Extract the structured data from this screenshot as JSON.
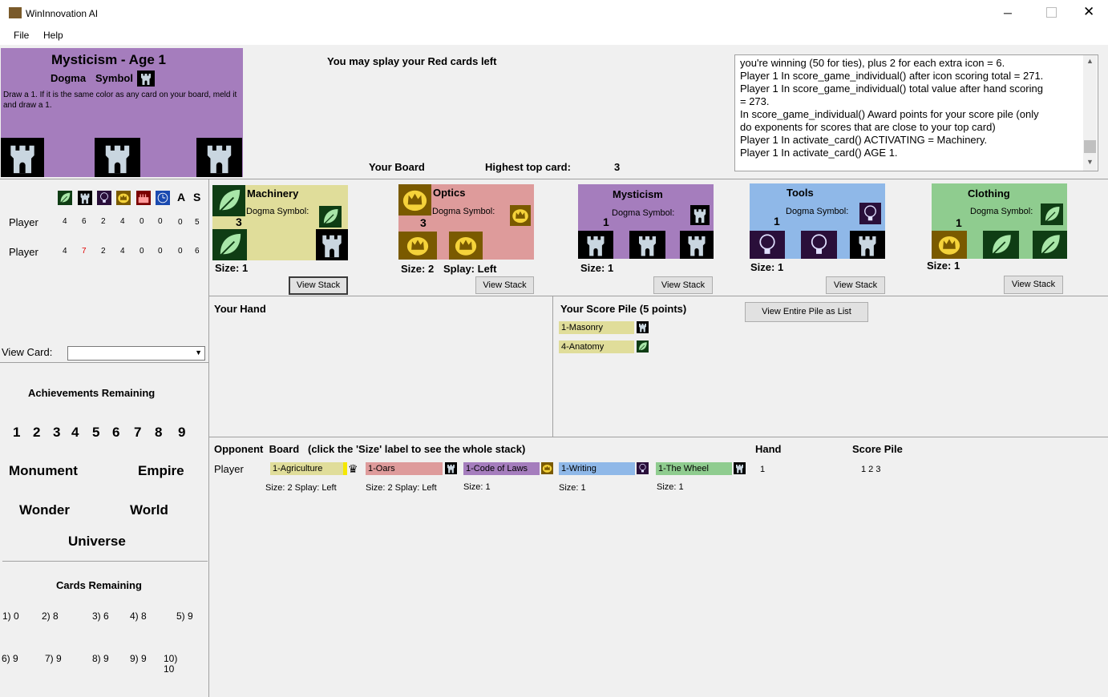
{
  "window": {
    "title": "WinInnovation AI"
  },
  "menu": {
    "file": "File",
    "help": "Help"
  },
  "selected_card": {
    "title": "Mysticism - Age 1",
    "dogma_label": "Dogma",
    "symbol_label": "Symbol",
    "text": "Draw a 1. If it is the same color as any card on your board, meld it and draw a 1.",
    "color": "#a57dbd"
  },
  "prompt": "You may splay your Red cards left",
  "log_lines": [
    "you're winning (50 for ties), plus 2 for each extra icon = 6.",
    "Player 1 In score_game_individual() after icon scoring total = 271.",
    "Player 1 In score_game_individual()  total value after hand scoring",
    "= 273.",
    "In score_game_individual()  Award points for your score pile (only",
    "do exponents for scores that are close to your top card)",
    "Player 1 In activate_card() ACTIVATING = Machinery.",
    "Player 1 In activate_card() AGE 1."
  ],
  "board_header": {
    "your_board": "Your Board",
    "highest_label": "Highest top card:",
    "highest_value": "3"
  },
  "icon_table": {
    "headers_text": [
      "A",
      "S"
    ],
    "rows": [
      {
        "label": "Player",
        "values": [
          "4",
          "6",
          "2",
          "4",
          "0",
          "0",
          "0",
          "5"
        ]
      },
      {
        "label": "Player",
        "values": [
          "4",
          "7",
          "2",
          "4",
          "0",
          "0",
          "0",
          "6"
        ]
      }
    ]
  },
  "view_card": {
    "label": "View Card:",
    "value": ""
  },
  "achievements": {
    "title": "Achievements Remaining",
    "numbers": [
      "1",
      "2",
      "3",
      "4",
      "5",
      "6",
      "7",
      "8",
      "9"
    ],
    "special": [
      "Monument",
      "Empire",
      "Wonder",
      "World",
      "Universe"
    ]
  },
  "cards_remaining": {
    "title": "Cards Remaining",
    "items": [
      "1) 0",
      "2) 8",
      "3) 6",
      "4) 8",
      "5) 9",
      "6) 9",
      "7) 9",
      "8) 9",
      "9) 9",
      "10)",
      "10"
    ]
  },
  "board_cards": [
    {
      "name": "Machinery",
      "dogma": "Dogma Symbol:",
      "age": "3",
      "size": "Size: 1",
      "splay": "",
      "button": "View Stack",
      "color": "#e0dd9a"
    },
    {
      "name": "Optics",
      "dogma": "Dogma Symbol:",
      "age": "3",
      "size": "Size: 2",
      "splay": "Splay: Left",
      "button": "View Stack",
      "color": "#de9b9b"
    },
    {
      "name": "Mysticism",
      "dogma": "Dogma Symbol:",
      "age": "1",
      "size": "Size: 1",
      "splay": "",
      "button": "View Stack",
      "color": "#a57dbd"
    },
    {
      "name": "Tools",
      "dogma": "Dogma Symbol:",
      "age": "1",
      "size": "Size: 1",
      "splay": "",
      "button": "View Stack",
      "color": "#8fb8e8"
    },
    {
      "name": "Clothing",
      "dogma": "Dogma Symbol:",
      "age": "1",
      "size": "Size: 1",
      "splay": "",
      "button": "View Stack",
      "color": "#8fcc8f"
    }
  ],
  "hand": {
    "title": "Your Hand"
  },
  "score_pile": {
    "title": "Your Score Pile (5 points)",
    "button": "View Entire Pile as List",
    "cards": [
      "1-Masonry",
      "4-Anatomy"
    ]
  },
  "opponent": {
    "title": "Opponent  Board   (click the 'Size' label to see the whole stack)",
    "hand_title": "Hand",
    "score_title": "Score Pile",
    "player_label": "Player",
    "hand_value": "1",
    "score_value": "1 2 3",
    "cards": [
      {
        "name": "1-Agriculture",
        "info": "Size: 2 Splay: Left",
        "color": "#e0dd9a"
      },
      {
        "name": "1-Oars",
        "info": "Size: 2 Splay: Left",
        "color": "#de9b9b"
      },
      {
        "name": "1-Code of Laws",
        "info": "Size: 1",
        "color": "#a57dbd"
      },
      {
        "name": "1-Writing",
        "info": "Size: 1",
        "color": "#8fb8e8"
      },
      {
        "name": "1-The Wheel",
        "info": "Size: 1",
        "color": "#8fcc8f"
      }
    ]
  }
}
